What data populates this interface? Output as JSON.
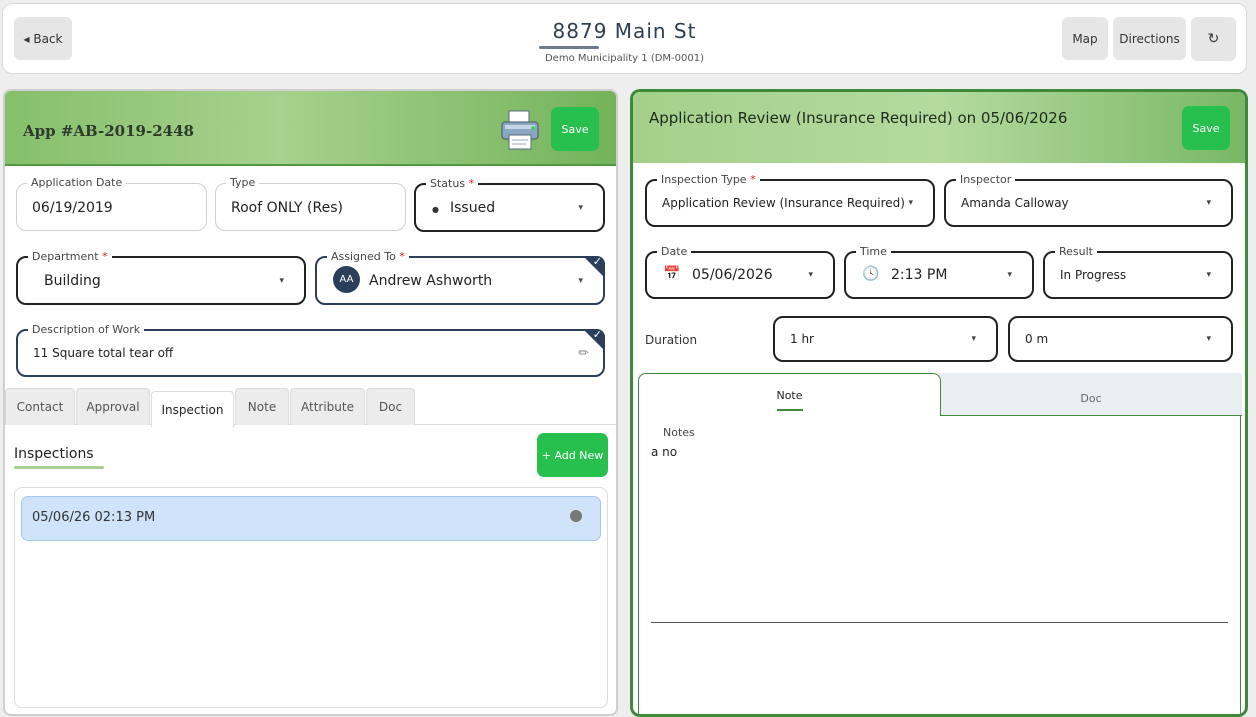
{
  "header": {
    "back_label": "◂ Back",
    "title": "8879 Main St",
    "subtitle": "Demo Municipality 1 (DM-0001)",
    "map_label": "Map",
    "directions_label": "Directions",
    "refresh_icon": "↻"
  },
  "app": {
    "title": "App #AB-2019-2448",
    "save_label": "Save",
    "application_date": {
      "label": "Application Date",
      "value": "06/19/2019"
    },
    "type": {
      "label": "Type",
      "value": "Roof ONLY (Res)"
    },
    "status": {
      "label": "Status",
      "required": "*",
      "value": "Issued",
      "bullet": "●"
    },
    "department": {
      "label": "Department",
      "required": "*",
      "value": "Building"
    },
    "assigned_to": {
      "label": "Assigned To",
      "required": "*",
      "initials": "AA",
      "value": "Andrew Ashworth"
    },
    "description": {
      "label": "Description of Work",
      "value": "11 Square total tear off"
    },
    "tabs": [
      {
        "label": "Contact"
      },
      {
        "label": "Approval"
      },
      {
        "label": "Inspection"
      },
      {
        "label": "Note"
      },
      {
        "label": "Attribute"
      },
      {
        "label": "Doc"
      }
    ],
    "inspections_title": "Inspections",
    "add_new_label": "+ Add New",
    "inspections": [
      {
        "datetime": "05/06/26 02:13 PM"
      }
    ]
  },
  "review": {
    "title": "Application Review (Insurance Required) on 05/06/2026",
    "save_label": "Save",
    "inspection_type": {
      "label": "Inspection Type",
      "required": "*",
      "value": "Application Review (Insurance Required)"
    },
    "inspector": {
      "label": "Inspector",
      "value": "Amanda Calloway"
    },
    "date": {
      "label": "Date",
      "value": "05/06/2026"
    },
    "time": {
      "label": "Time",
      "value": "2:13 PM"
    },
    "result": {
      "label": "Result",
      "value": "In Progress"
    },
    "duration_label": "Duration",
    "duration_hours": "1 hr",
    "duration_minutes": "0 m",
    "note_tab": "Note",
    "doc_tab": "Doc",
    "notes_label": "Notes",
    "notes_value": "a no"
  },
  "colors": {
    "accent_green": "#27c04e",
    "panel_green": "#3f8a3a",
    "navy": "#2b3f5a",
    "row_blue": "#cfe3fb"
  },
  "icons": {
    "caret": "▾",
    "check": "✓",
    "pencil": "✏",
    "calendar": "📅",
    "clock": "🕓"
  }
}
